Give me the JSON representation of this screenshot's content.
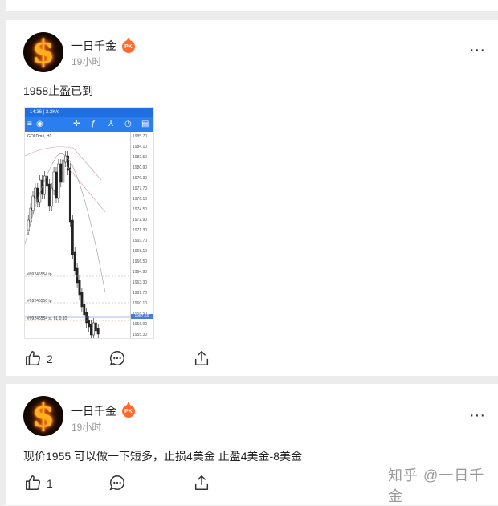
{
  "feed": {
    "posts": [
      {
        "author": "一日千金",
        "badge": "PK",
        "time": "19小时",
        "text": "1958止盈已到",
        "likes": "2",
        "has_image": true
      },
      {
        "author": "一日千金",
        "badge": "PK",
        "time": "19小时",
        "text": "现价1955 可以做一下短多，止损4美金 止盈4美金-8美金",
        "likes": "1",
        "has_image": false
      }
    ]
  },
  "chart_image": {
    "status_time": "14:36 | 2.3K/s",
    "symbol": "GOLDm#, H1",
    "price_labels": [
      "1985.70",
      "1984.10",
      "1982.50",
      "1980.90",
      "1979.30",
      "1977.70",
      "1976.10",
      "1974.50",
      "1972.90",
      "1971.30",
      "1969.70",
      "1968.10",
      "1966.50",
      "1964.90",
      "1963.30",
      "1961.70",
      "1960.10",
      "1958.50",
      "1956.90",
      "1955.30"
    ],
    "current_price": "1957.60",
    "orders": [
      "#99246554 tp",
      "#99246550 tp",
      "#99246554 sl, 8L 0.10"
    ]
  },
  "watermark": "知乎 @一日千金",
  "colors": {
    "accent": "#2b7ef0",
    "badge": "#ff6a2c",
    "background": "#ececec"
  },
  "icons": [
    "like-icon",
    "comment-icon",
    "share-icon",
    "more-icon",
    "pk-badge-icon"
  ]
}
